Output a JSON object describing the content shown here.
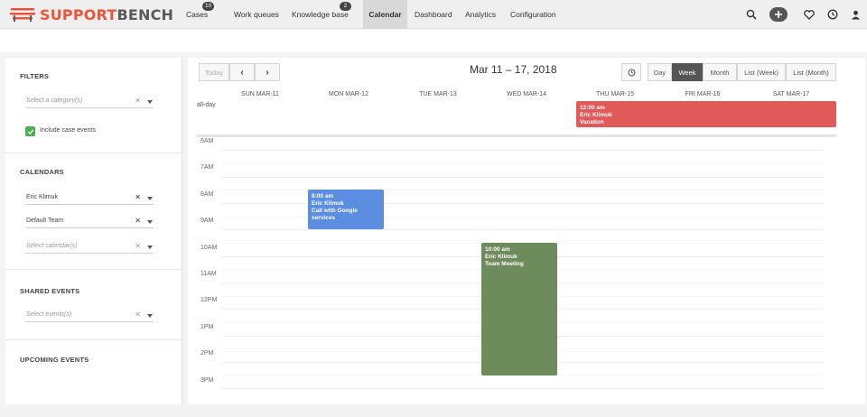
{
  "brand": {
    "part1": "SUPPORT",
    "part2": "BENCH",
    "accent": "#e8553b"
  },
  "nav": {
    "cases": {
      "label": "Cases",
      "badge": "10"
    },
    "work_queues": {
      "label": "Work queues"
    },
    "knowledge_base": {
      "label": "Knowledge base",
      "badge": "2"
    },
    "calendar": {
      "label": "Calendar"
    },
    "dashboard": {
      "label": "Dashboard"
    },
    "analytics": {
      "label": "Analytics"
    },
    "configuration": {
      "label": "Configuration"
    },
    "icons": [
      "search-icon",
      "plus-icon",
      "heart-icon",
      "clock-icon",
      "user-icon"
    ]
  },
  "sidebar": {
    "filters": {
      "title": "FILTERS",
      "category_placeholder": "Select a category(s)",
      "include_case_events": "Include case events",
      "include_checked": true
    },
    "calendars": {
      "title": "CALENDARS",
      "selected": [
        "Eric Klimuk",
        "Default Team"
      ],
      "placeholder": "Select calendar(s)"
    },
    "shared_events": {
      "title": "SHARED EVENTS",
      "placeholder": "Select events(s)"
    },
    "upcoming_events": {
      "title": "UPCOMING EVENTS"
    }
  },
  "calendar": {
    "today": "Today",
    "prev": "‹",
    "next": "›",
    "title": "Mar 11 – 17, 2018",
    "views": [
      "Day",
      "Week",
      "Month",
      "List (Week)",
      "List (Month)"
    ],
    "active_view": "Week",
    "allday": "all-day",
    "days": [
      "SUN MAR-11",
      "MON MAR-12",
      "TUE MAR-13",
      "WED MAR-14",
      "THU MAR-15",
      "FRI MAR-16",
      "SAT MAR-17"
    ],
    "hours": [
      "6AM",
      "7AM",
      "8AM",
      "9AM",
      "10AM",
      "11AM",
      "12PM",
      "1PM",
      "2PM",
      "3PM"
    ],
    "events": [
      {
        "time": "12:00 am",
        "person": "Eric Klimuk",
        "title": "Vacation",
        "color": "#e05a5a"
      },
      {
        "time": "8:00 am",
        "person": "Eric Klimuk",
        "title": "Call with Google services",
        "color": "#5b8de0"
      },
      {
        "time": "10:00 am",
        "person": "Eric Klimuk",
        "title": "Team Meeting",
        "color": "#6e8b5c"
      }
    ]
  }
}
